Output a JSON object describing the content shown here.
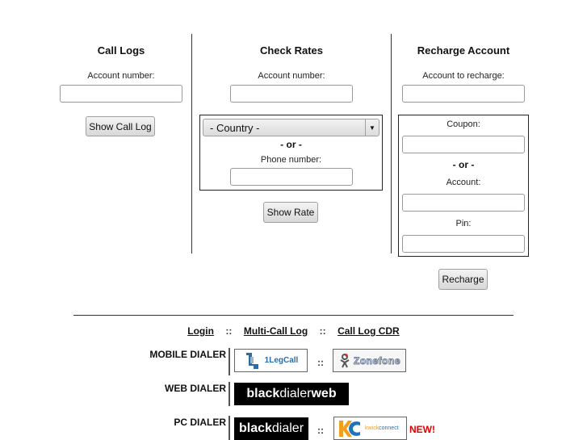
{
  "call_logs": {
    "heading": "Call Logs",
    "account_label": "Account number:",
    "account_value": "",
    "button": "Show Call Log"
  },
  "check_rates": {
    "heading": "Check Rates",
    "account_label": "Account number:",
    "account_value": "",
    "country_select": "- Country -",
    "or_text": "- or -",
    "phone_label": "Phone number:",
    "phone_value": "",
    "button": "Show Rate"
  },
  "recharge": {
    "heading": "Recharge Account",
    "account_label": "Account to recharge:",
    "account_value": "",
    "coupon_label": "Coupon:",
    "coupon_value": "",
    "or_text": "- or -",
    "acct_label": "Account:",
    "acct_value": "",
    "pin_label": "Pin:",
    "pin_value": "",
    "button": "Recharge"
  },
  "nav": {
    "links": [
      "Login",
      "Multi-Call Log",
      "Call Log CDR"
    ],
    "separator": "::"
  },
  "dialers": {
    "mobile_label": "MOBILE DIALER",
    "web_label": "WEB DIALER",
    "pc_label": "PC DIALER",
    "separator": "::",
    "logos": {
      "onelegcall": "1LegCall",
      "zonefone": "Zonefone",
      "blackdialerweb_bold": "black",
      "blackdialerweb_mid": "dialer",
      "blackdialerweb_end": "web",
      "blackdialer_bold": "black",
      "blackdialer_mid": "dialer",
      "kwickconnect_a": "kwick",
      "kwickconnect_b": "connect"
    },
    "new_badge": "NEW!"
  },
  "colors": {
    "new_badge": "#e00000",
    "kwick_orange": "#f0a020",
    "kwick_blue": "#1b75bb",
    "onelegcall_blue": "#2a6ca8"
  }
}
